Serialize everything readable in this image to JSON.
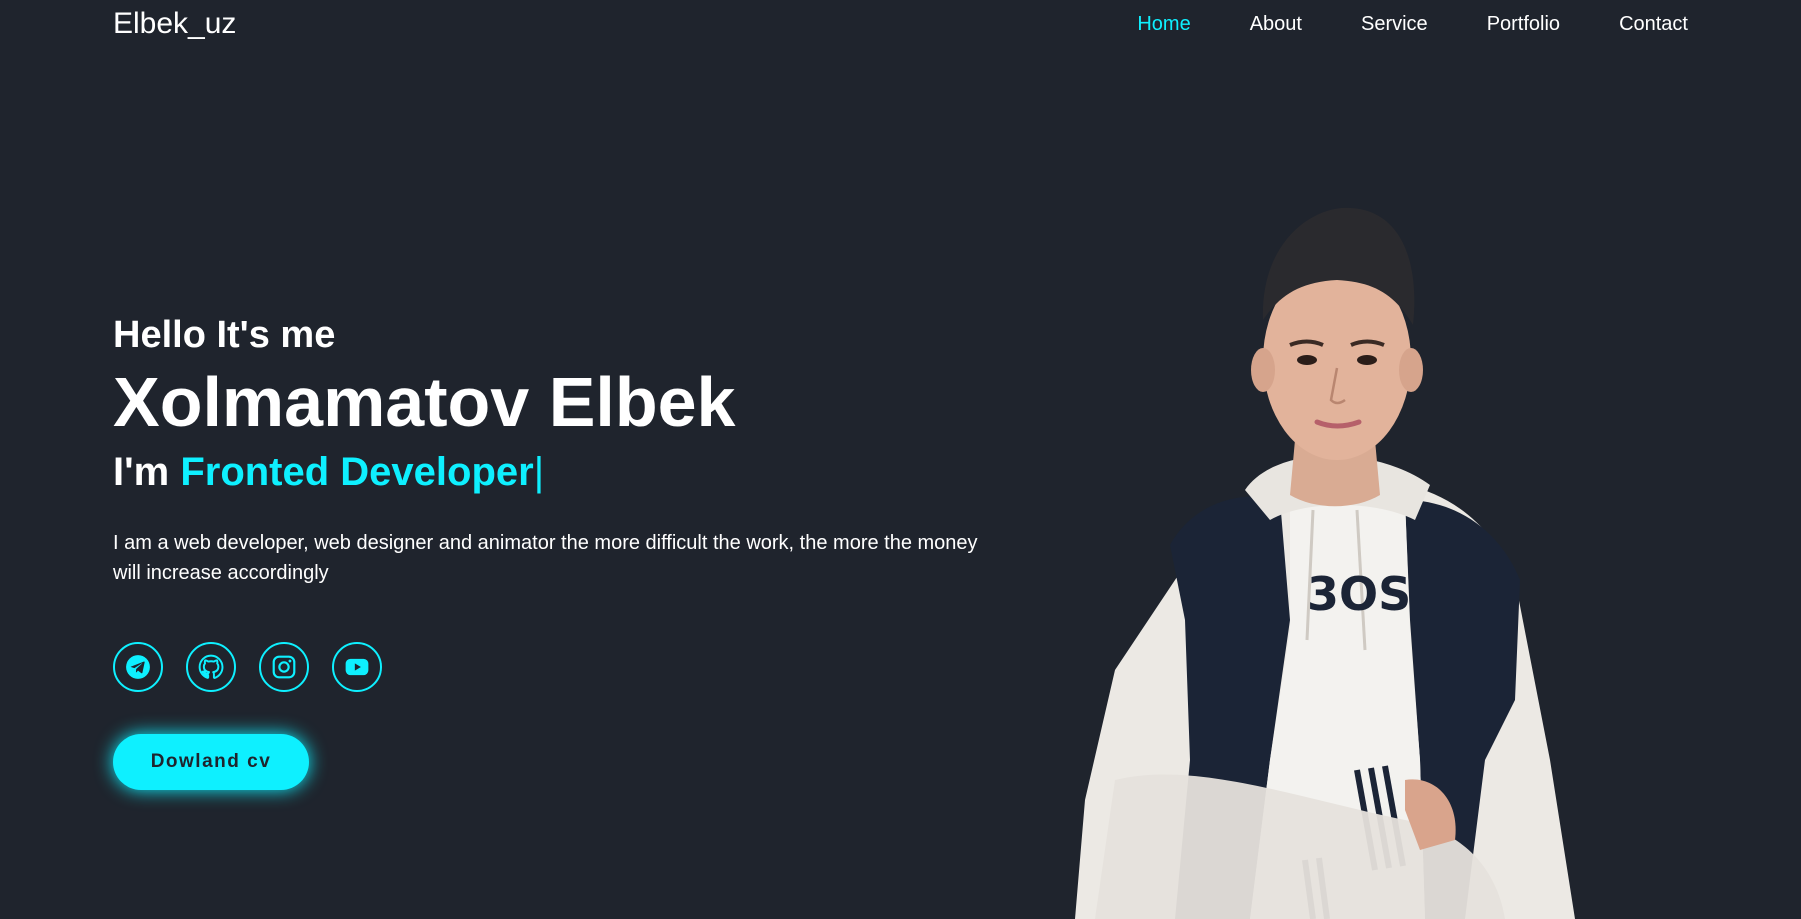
{
  "header": {
    "logo": "Elbek_uz",
    "nav": [
      {
        "label": "Home",
        "active": true
      },
      {
        "label": "About",
        "active": false
      },
      {
        "label": "Service",
        "active": false
      },
      {
        "label": "Portfolio",
        "active": false
      },
      {
        "label": "Contact",
        "active": false
      }
    ]
  },
  "hero": {
    "greeting": "Hello It's me",
    "name": "Xolmamatov Elbek",
    "role_prefix": "I'm ",
    "role": "Fronted Developer",
    "cursor": "|",
    "description": "I am a web developer, web designer and animator the more difficult the work, the more the money will increase accordingly",
    "socials": [
      {
        "icon": "telegram-icon"
      },
      {
        "icon": "github-icon"
      },
      {
        "icon": "instagram-icon"
      },
      {
        "icon": "youtube-icon"
      }
    ],
    "cta_label": "Dowland cv"
  },
  "colors": {
    "background": "#1f242d",
    "accent": "#0ef0ff",
    "text": "#ffffff"
  }
}
